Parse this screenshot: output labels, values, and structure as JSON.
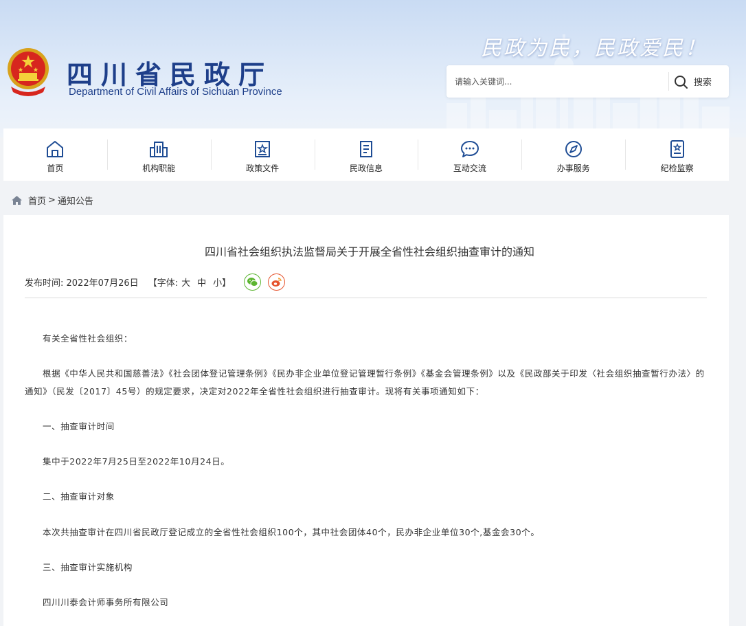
{
  "header": {
    "title": "四川省民政厅",
    "subtitle": "Department of Civil Affairs of Sichuan Province",
    "slogan": "民政为民，民政爱民！",
    "emblem_icon": "national-emblem-icon"
  },
  "search": {
    "placeholder": "请输入关键词...",
    "button_label": "搜索"
  },
  "nav": {
    "items": [
      {
        "label": "首页",
        "icon": "home-icon"
      },
      {
        "label": "机构职能",
        "icon": "building-icon"
      },
      {
        "label": "政策文件",
        "icon": "star-document-icon"
      },
      {
        "label": "民政信息",
        "icon": "news-document-icon"
      },
      {
        "label": "互动交流",
        "icon": "chat-bubble-icon"
      },
      {
        "label": "办事服务",
        "icon": "compass-icon"
      },
      {
        "label": "纪检监察",
        "icon": "badge-document-icon"
      }
    ]
  },
  "breadcrumb": {
    "home": "首页",
    "separator": ">",
    "current": "通知公告"
  },
  "article": {
    "title": "四川省社会组织执法监督局关于开展全省性社会组织抽查审计的通知",
    "date": "发布时间: 2022年07月26日",
    "font_label": "【字体:",
    "font_large": "大",
    "font_medium": "中",
    "font_small": "小】",
    "paragraphs": [
      "有关全省性社会组织：",
      "根据《中华人民共和国慈善法》《社会团体登记管理条例》《民办非企业单位登记管理暂行条例》《基金会管理条例》以及《民政部关于印发〈社会组织抽查暂行办法〉的通知》（民发〔2017〕45号）的规定要求，决定对2022年全省性社会组织进行抽查审计。现将有关事项通知如下：",
      "一、抽查审计时间",
      "集中于2022年7月25日至2022年10月24日。",
      "二、抽查审计对象",
      "本次共抽查审计在四川省民政厅登记成立的全省性社会组织100个，其中社会团体40个，民办非企业单位30个,基金会30个。",
      "三、抽查审计实施机构",
      "四川川泰会计师事务所有限公司"
    ]
  },
  "colors": {
    "brand_blue": "#1e3f8a",
    "icon_blue": "#1e4c94",
    "wechat_green": "#5cb531",
    "weibo_red": "#e5532d"
  }
}
